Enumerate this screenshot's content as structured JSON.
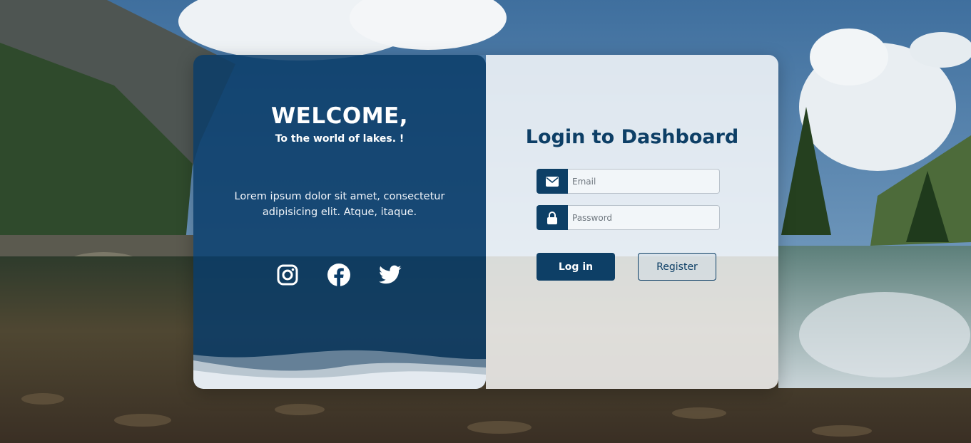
{
  "welcome": {
    "title": "WELCOME,",
    "subtitle": "To the world of lakes. !",
    "body": "Lorem ipsum dolor sit amet, consectetur adipisicing elit. Atque, itaque."
  },
  "socials": [
    {
      "icon": "instagram-icon"
    },
    {
      "icon": "facebook-icon"
    },
    {
      "icon": "twitter-icon"
    }
  ],
  "login": {
    "title": "Login to Dashboard",
    "email": {
      "placeholder": "Email",
      "value": "",
      "icon": "envelope-icon"
    },
    "password": {
      "placeholder": "Password",
      "value": "",
      "icon": "lock-icon"
    },
    "login_label": "Log in",
    "register_label": "Register"
  },
  "colors": {
    "primary": "#0d3f66",
    "panel_overlay": "#0a3c69",
    "white": "#ffffff"
  }
}
